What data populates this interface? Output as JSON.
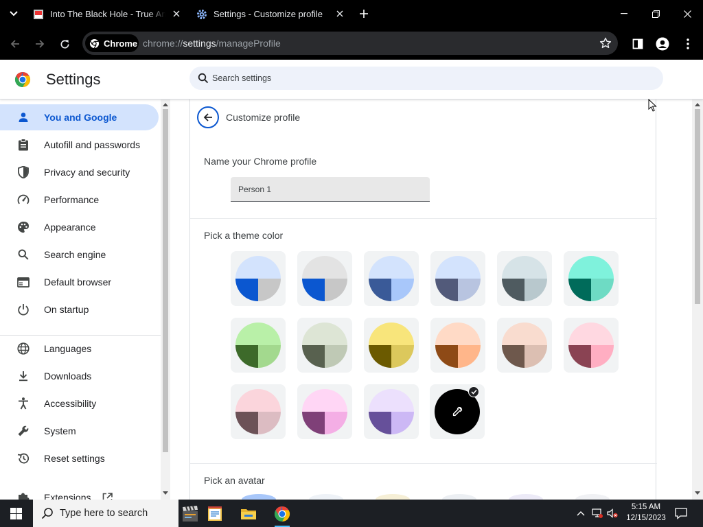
{
  "browser": {
    "tabs": [
      {
        "title": "Into The Black Hole - True Amol",
        "active": false
      },
      {
        "title": "Settings - Customize profile",
        "active": true
      }
    ],
    "chip_label": "Chrome",
    "url_scheme": "chrome://",
    "url_host": "settings",
    "url_path": "/manageProfile"
  },
  "settings": {
    "title": "Settings",
    "search_placeholder": "Search settings"
  },
  "sidebar": {
    "items": [
      {
        "label": "You and Google",
        "icon": "person-icon",
        "active": true
      },
      {
        "label": "Autofill and passwords",
        "icon": "clipboard-icon"
      },
      {
        "label": "Privacy and security",
        "icon": "shield-icon"
      },
      {
        "label": "Performance",
        "icon": "gauge-icon"
      },
      {
        "label": "Appearance",
        "icon": "palette-icon"
      },
      {
        "label": "Search engine",
        "icon": "search-icon"
      },
      {
        "label": "Default browser",
        "icon": "browser-window-icon"
      },
      {
        "label": "On startup",
        "icon": "power-icon"
      },
      {
        "label": "Languages",
        "icon": "globe-icon"
      },
      {
        "label": "Downloads",
        "icon": "download-icon"
      },
      {
        "label": "Accessibility",
        "icon": "accessibility-icon"
      },
      {
        "label": "System",
        "icon": "wrench-icon"
      },
      {
        "label": "Reset settings",
        "icon": "history-icon"
      },
      {
        "label": "Extensions",
        "icon": "puzzle-icon"
      }
    ]
  },
  "profile": {
    "page_title": "Customize profile",
    "name_section": "Name your Chrome profile",
    "name_value": "Person 1",
    "theme_section": "Pick a theme color",
    "avatar_section": "Pick an avatar",
    "selected_theme": "custom-color-picker",
    "themes": [
      {
        "top": "#d3e3fd",
        "left": "#0b57d0",
        "right": "#c7c7c7"
      },
      {
        "top": "#e3e3e3",
        "left": "#0b57d0",
        "right": "#c7c7c7"
      },
      {
        "top": "#d3e3fd",
        "left": "#3a5a98",
        "right": "#a8c7fa"
      },
      {
        "top": "#d3e3fd",
        "left": "#525a7a",
        "right": "#b8c4e0"
      },
      {
        "top": "#d6e3e7",
        "left": "#4f5b60",
        "right": "#b8c8cd"
      },
      {
        "top": "#7ff2dc",
        "left": "#006b5a",
        "right": "#6edbc4"
      },
      {
        "top": "#b9f0a8",
        "left": "#3d6a2a",
        "right": "#a3d98e"
      },
      {
        "top": "#dde5d5",
        "left": "#58614f",
        "right": "#bfc9b5"
      },
      {
        "top": "#f8e57b",
        "left": "#6b5a00",
        "right": "#dcc85c"
      },
      {
        "top": "#ffdac6",
        "left": "#8e4a16",
        "right": "#ffb68a"
      },
      {
        "top": "#f9dccf",
        "left": "#6e584c",
        "right": "#dcbfb2"
      },
      {
        "top": "#ffd8e1",
        "left": "#8a4353",
        "right": "#ffaec2"
      },
      {
        "top": "#fbd5dc",
        "left": "#6c5257",
        "right": "#dcbcc2"
      },
      {
        "top": "#ffd6f5",
        "left": "#7f4078",
        "right": "#f4aee5"
      },
      {
        "top": "#ece0fd",
        "left": "#66509a",
        "right": "#ccb8f5"
      }
    ]
  },
  "taskbar": {
    "search_placeholder": "Type here to search",
    "time": "5:15 AM",
    "date": "12/15/2023"
  },
  "colors": {
    "accent": "#0b57d0",
    "active_nav_bg": "#d3e3fd"
  }
}
